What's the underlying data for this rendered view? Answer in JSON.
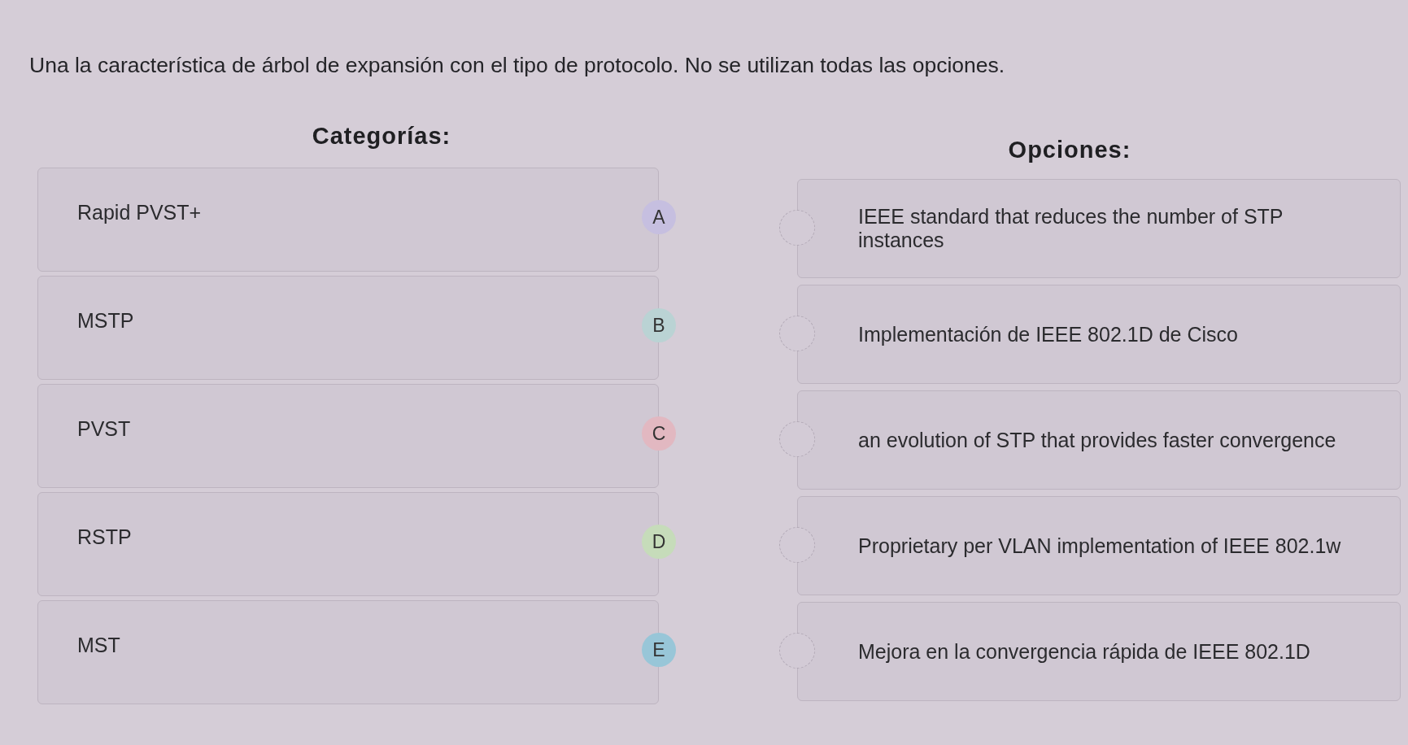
{
  "instructions": "Una la característica de árbol de expansión con el tipo de protocolo. No se utilizan todas las opciones.",
  "categories": {
    "heading": "Categorías:",
    "items": [
      {
        "label": "Rapid PVST+",
        "letter": "A",
        "color": "#c6bfe0"
      },
      {
        "label": "MSTP",
        "letter": "B",
        "color": "#bad3d4"
      },
      {
        "label": "PVST",
        "letter": "C",
        "color": "#e2b8c1"
      },
      {
        "label": "RSTP",
        "letter": "D",
        "color": "#c6dcba"
      },
      {
        "label": "MST",
        "letter": "E",
        "color": "#98c6d8"
      }
    ]
  },
  "options": {
    "heading": "Opciones:",
    "items": [
      {
        "text": "IEEE standard that reduces the number of STP instances"
      },
      {
        "text": "Implementación de IEEE 802.1D de Cisco"
      },
      {
        "text": "an evolution of STP that provides faster convergence"
      },
      {
        "text": "Proprietary per VLAN implementation of IEEE 802.1w"
      },
      {
        "text": "Mejora en la convergencia rápida de IEEE 802.1D"
      }
    ]
  }
}
